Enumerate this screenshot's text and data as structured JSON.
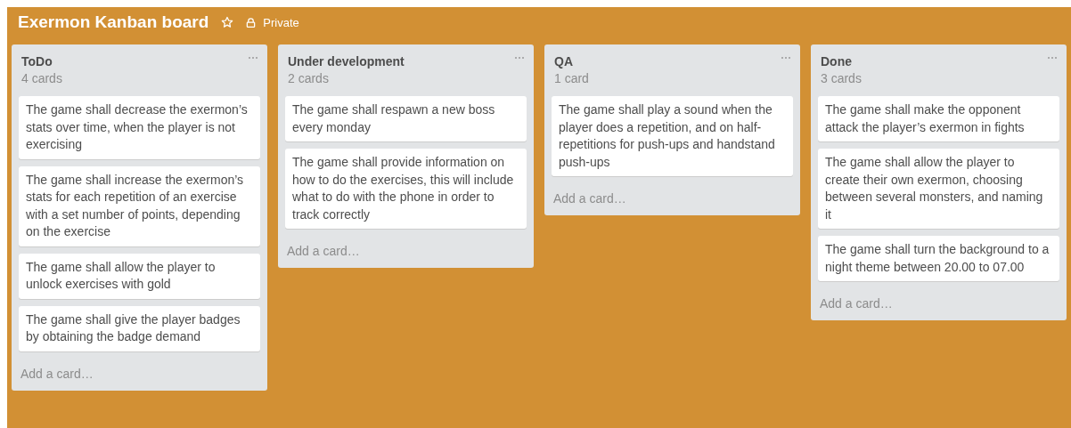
{
  "board": {
    "title": "Exermon Kanban board",
    "visibility": "Private"
  },
  "lists": [
    {
      "name": "ToDo",
      "count": "4 cards",
      "cards": [
        "The game shall decrease the exermon’s stats over time, when the player is not exercising",
        "The game shall increase the exermon’s stats for each repetition of an exercise with a set number of points, depending on the exercise",
        "The game shall allow the player to unlock exercises with gold",
        "The game shall give the player badges by obtaining the badge demand"
      ],
      "add": "Add a card…"
    },
    {
      "name": "Under development",
      "count": "2 cards",
      "cards": [
        "The game shall respawn a new boss every monday",
        "The game shall provide information on how to do the exercises, this will include what to do with the phone in order to track correctly"
      ],
      "add": "Add a card…"
    },
    {
      "name": "QA",
      "count": "1 card",
      "cards": [
        "The game shall play a sound when the player does a repetition, and on half-repetitions for push-ups and handstand push-ups"
      ],
      "add": "Add a card…"
    },
    {
      "name": "Done",
      "count": "3 cards",
      "cards": [
        "The game shall make the opponent attack the player’s exermon in fights",
        "The game shall allow the player to create their own exermon, choosing between several monsters, and naming it",
        "The game shall turn the background to a night theme between 20.00 to 07.00"
      ],
      "add": "Add a card…"
    }
  ]
}
